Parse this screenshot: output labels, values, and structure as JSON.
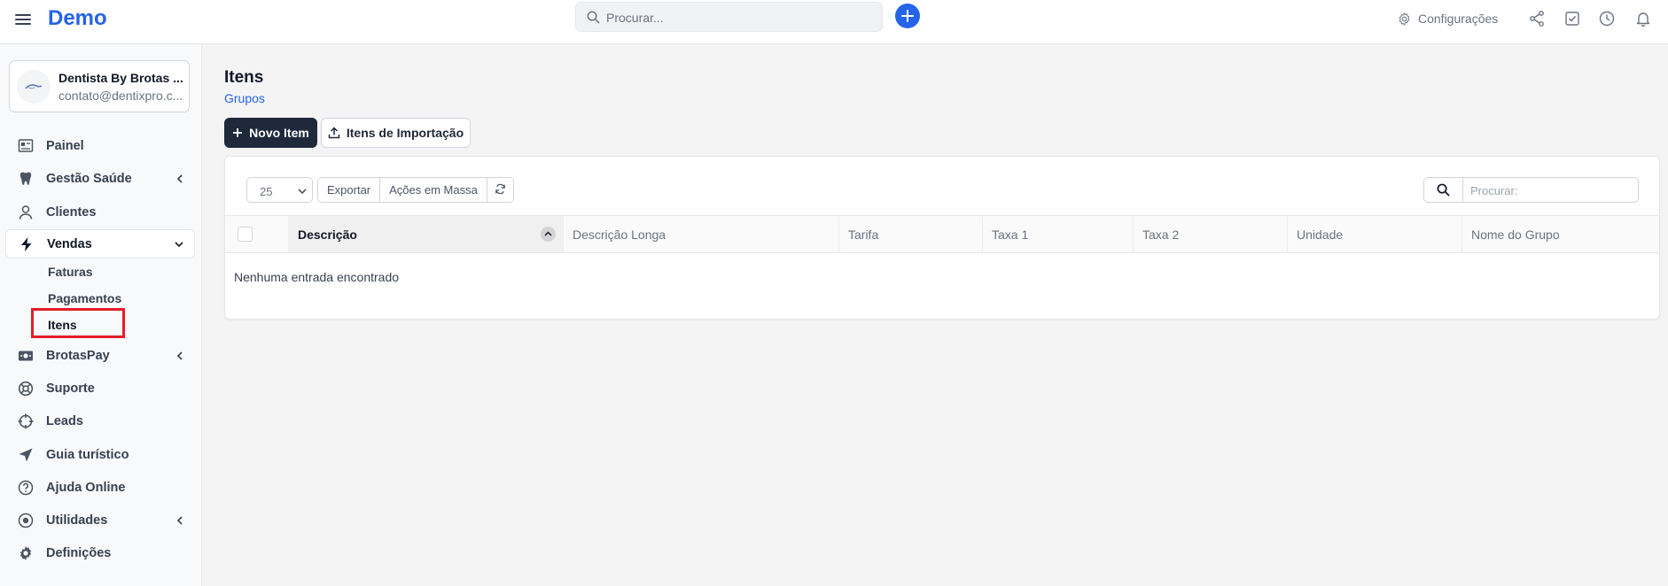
{
  "topbar": {
    "brand": "Demo",
    "search_placeholder": "Procurar...",
    "settings_label": "Configurações"
  },
  "sidebar": {
    "company": {
      "name": "Dentista By Brotas ...",
      "email": "contato@dentixpro.c..."
    },
    "items": [
      {
        "label": "Painel"
      },
      {
        "label": "Gestão Saúde"
      },
      {
        "label": "Clientes"
      },
      {
        "label": "Vendas"
      },
      {
        "label": "BrotasPay"
      },
      {
        "label": "Suporte"
      },
      {
        "label": "Leads"
      },
      {
        "label": "Guia turístico"
      },
      {
        "label": "Ajuda Online"
      },
      {
        "label": "Utilidades"
      },
      {
        "label": "Definições"
      }
    ],
    "vendas_sub": [
      {
        "label": "Faturas"
      },
      {
        "label": "Pagamentos"
      },
      {
        "label": "Itens"
      }
    ]
  },
  "main": {
    "title": "Itens",
    "groups_link": "Grupos",
    "new_item_label": "Novo Item",
    "import_label": "Itens de Importação"
  },
  "table": {
    "page_size": "25",
    "export_label": "Exportar",
    "bulk_label": "Ações em Massa",
    "search_placeholder": "Procurar:",
    "columns": [
      "Descrição",
      "Descrição Longa",
      "Tarifa",
      "Taxa 1",
      "Taxa 2",
      "Unidade",
      "Nome do Grupo"
    ],
    "empty_message": "Nenhuma entrada encontrado"
  },
  "colors": {
    "accent": "#2563eb",
    "dark_button": "#1e293b",
    "highlight": "#e11d2a"
  }
}
